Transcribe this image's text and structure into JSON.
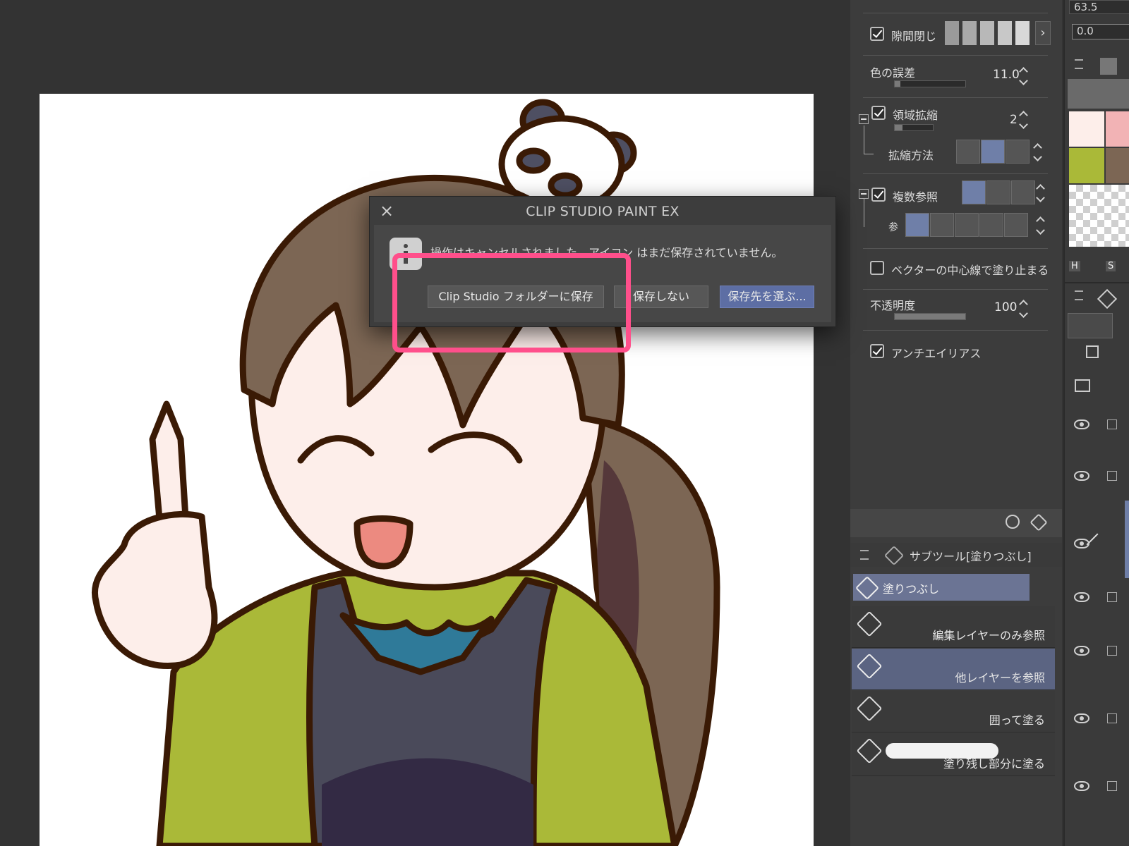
{
  "app": {
    "name": "CLIP STUDIO PAINT EX"
  },
  "dialog": {
    "title": "CLIP STUDIO PAINT EX",
    "message": "操作はキャンセルされました。アイコン はまだ保存されていません。",
    "buttons": {
      "save_clip_folder": "Clip Studio フォルダーに保存",
      "dont_save": "保存しない",
      "choose_location": "保存先を選ぶ..."
    },
    "highlight_color": "#ff4f8b"
  },
  "tool_property": {
    "top_value": "63.5",
    "top_value2": "0.0",
    "gap_close": {
      "label": "隙間閉じ",
      "checked": true
    },
    "color_tolerance": {
      "label": "色の誤差",
      "value": "11.0"
    },
    "area_scaling": {
      "label": "領域拡縮",
      "value": "2",
      "checked": true
    },
    "scaling_method": {
      "label": "拡縮方法"
    },
    "multiple_reference": {
      "label": "複数参照",
      "checked": true
    },
    "reference_short": {
      "label": "参"
    },
    "vector_stop": {
      "label": "ベクターの中心線で塗り止まる",
      "checked": false
    },
    "opacity": {
      "label": "不透明度",
      "value": "100"
    },
    "antialias": {
      "label": "アンチエイリアス",
      "checked": true
    }
  },
  "sub_tool": {
    "header": "サブツール[塗りつぶし]",
    "group": "塗りつぶし",
    "items": [
      {
        "label": "編集レイヤーのみ参照",
        "selected": false
      },
      {
        "label": "他レイヤーを参照",
        "selected": true
      },
      {
        "label": "囲って塗る",
        "selected": false
      },
      {
        "label": "塗り残し部分に塗る",
        "selected": false
      }
    ]
  },
  "color_panel": {
    "tab_h": "H",
    "tab_s": "S"
  },
  "colors": {
    "accent": "#6f7fa8",
    "skin": "#fdeeea",
    "hair": "#7c6654",
    "jacket": "#aab938",
    "outline": "#3a1a05"
  }
}
